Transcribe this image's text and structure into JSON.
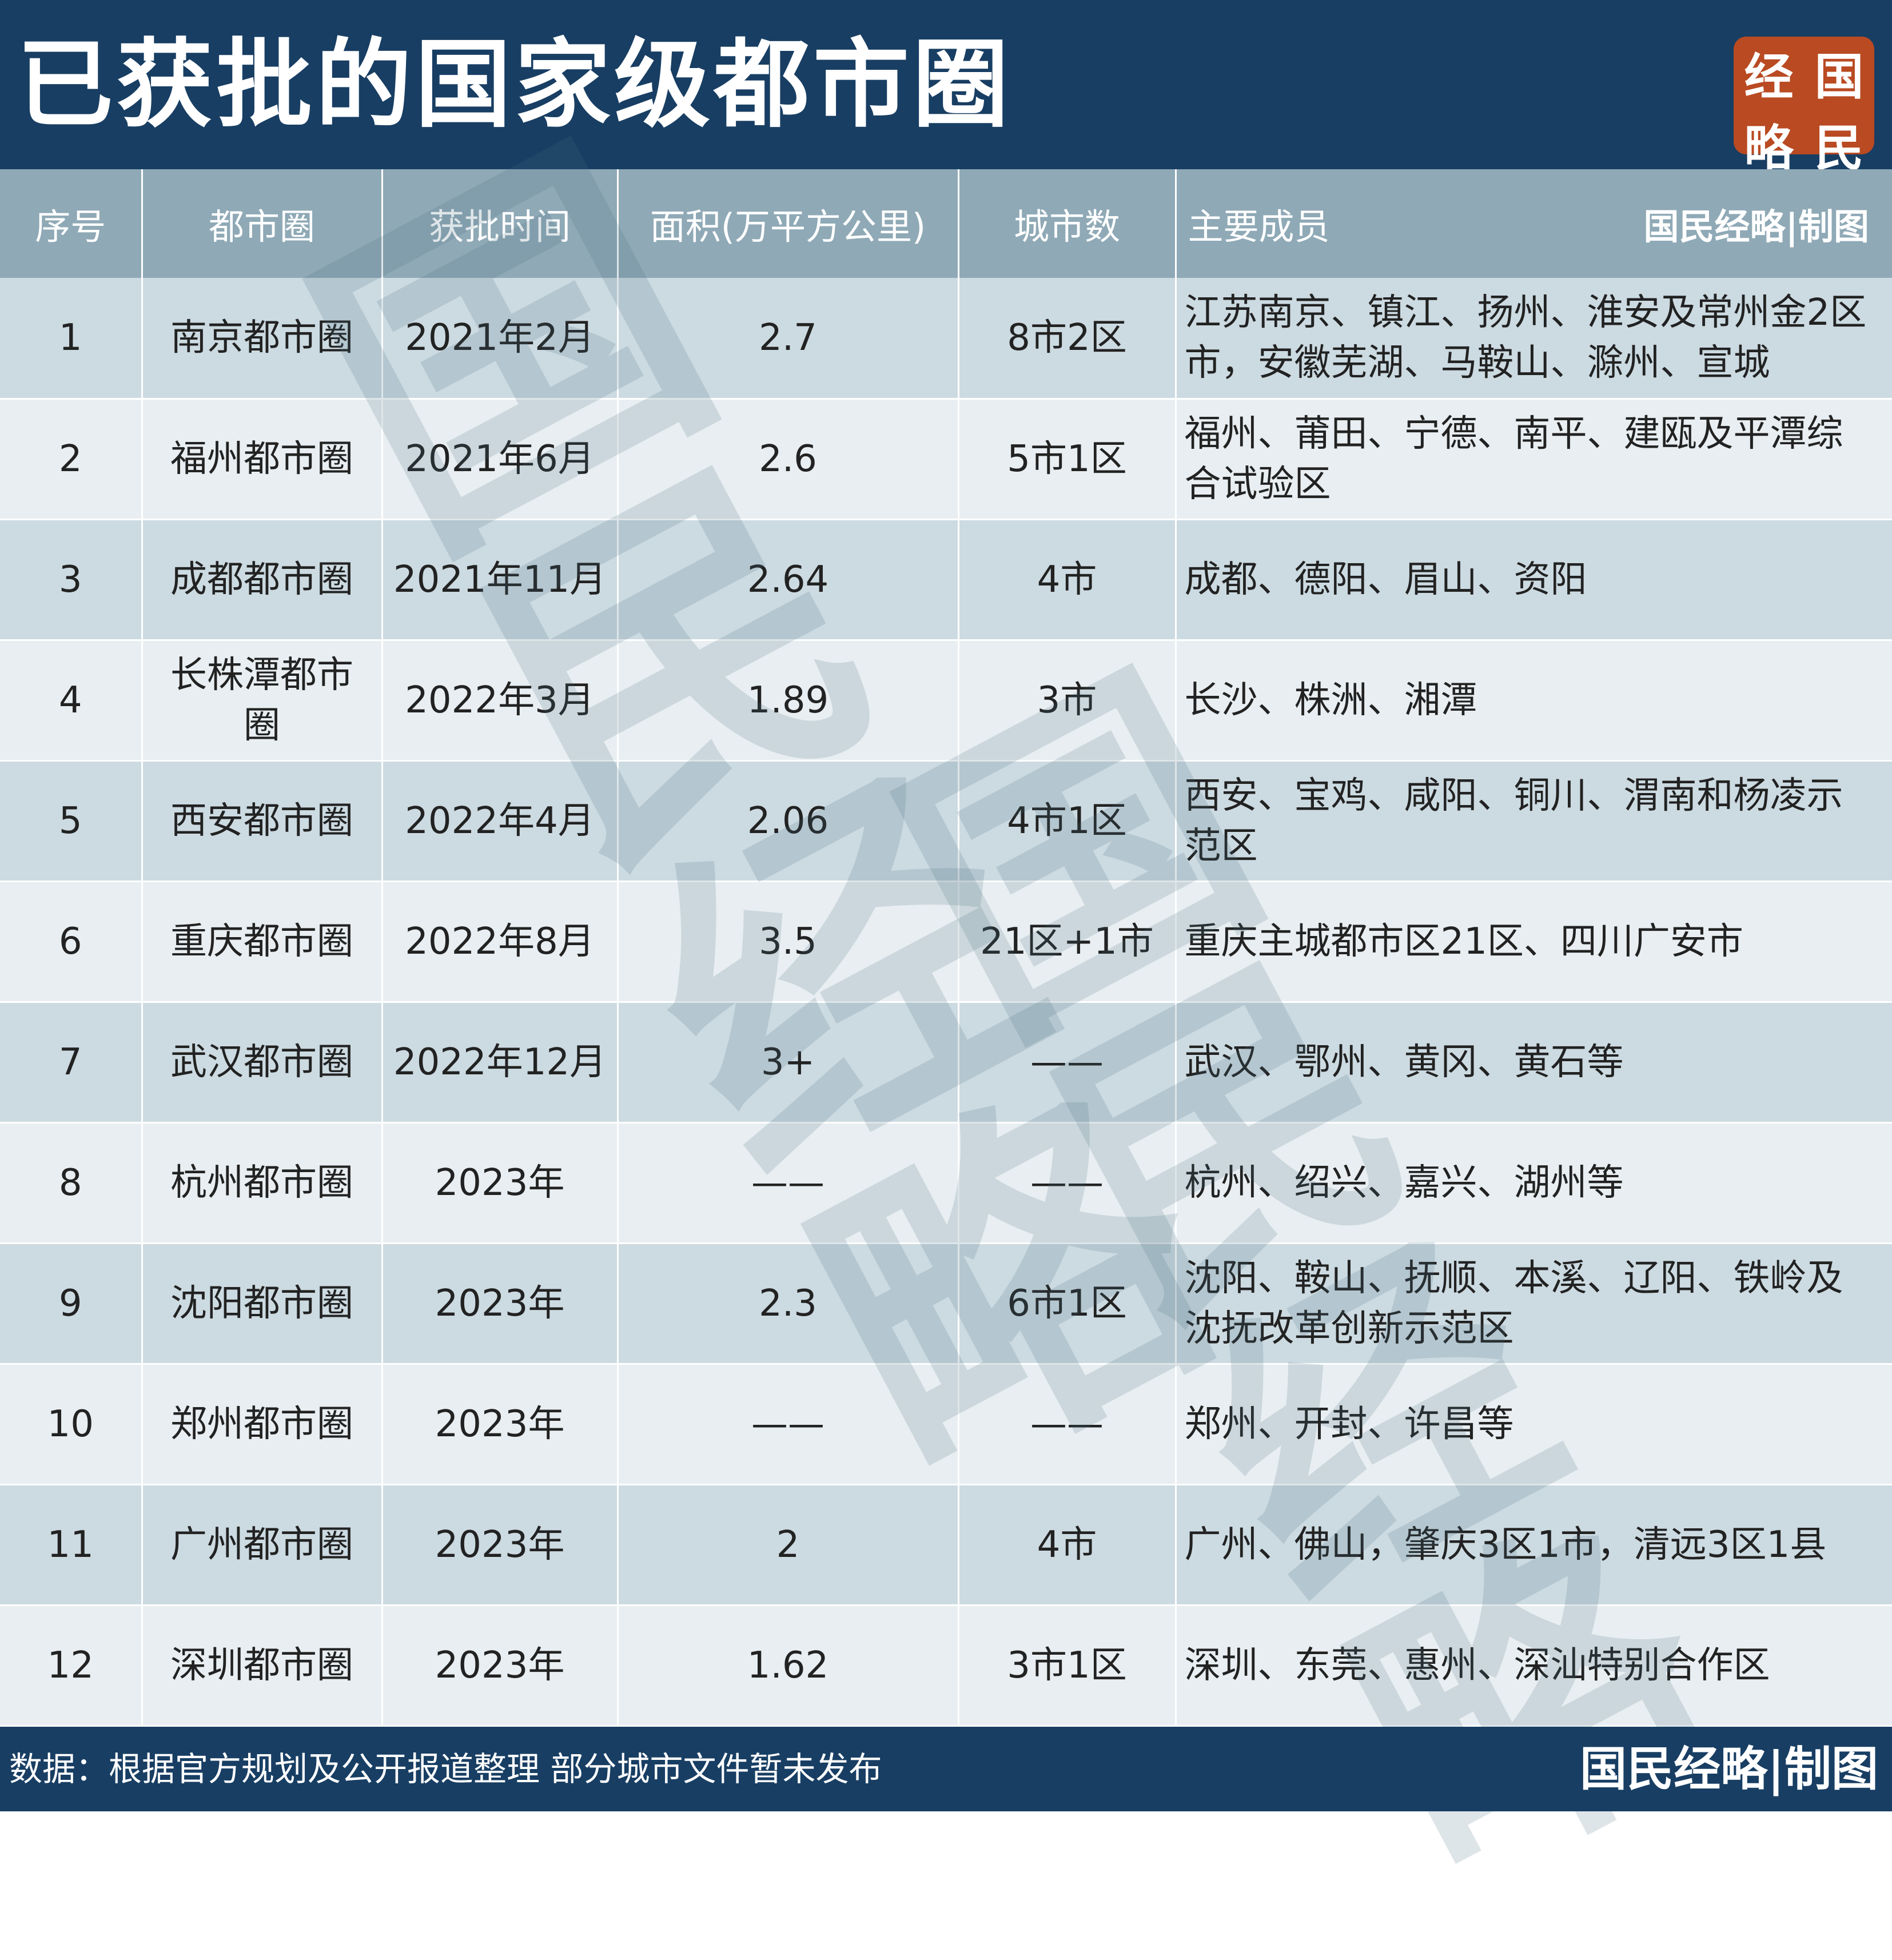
{
  "header": {
    "title": "已获批的国家级都市圈",
    "logo_chars": [
      "国",
      "经",
      "民",
      "略"
    ]
  },
  "watermark_text": "国民经略",
  "table": {
    "columns": [
      "序号",
      "都市圈",
      "获批时间",
      "面积(万平方公里)",
      "城市数",
      "主要成员"
    ],
    "header_credit": "国民经略|制图",
    "rows": [
      {
        "no": "1",
        "name": "南京都市圈",
        "date": "2021年2月",
        "area": "2.7",
        "cities": "8市2区",
        "members": "江苏南京、镇江、扬州、淮安及常州金2区市，安徽芜湖、马鞍山、滁州、宣城"
      },
      {
        "no": "2",
        "name": "福州都市圈",
        "date": "2021年6月",
        "area": "2.6",
        "cities": "5市1区",
        "members": "福州、莆田、宁德、南平、建瓯及平潭综合试验区"
      },
      {
        "no": "3",
        "name": "成都都市圈",
        "date": "2021年11月",
        "area": "2.64",
        "cities": "4市",
        "members": "成都、德阳、眉山、资阳"
      },
      {
        "no": "4",
        "name": "长株潭都市圈",
        "date": "2022年3月",
        "area": "1.89",
        "cities": "3市",
        "members": "长沙、株洲、湘潭"
      },
      {
        "no": "5",
        "name": "西安都市圈",
        "date": "2022年4月",
        "area": "2.06",
        "cities": "4市1区",
        "members": "西安、宝鸡、咸阳、铜川、渭南和杨凌示范区"
      },
      {
        "no": "6",
        "name": "重庆都市圈",
        "date": "2022年8月",
        "area": "3.5",
        "cities": "21区+1市",
        "members": "重庆主城都市区21区、四川广安市"
      },
      {
        "no": "7",
        "name": "武汉都市圈",
        "date": "2022年12月",
        "area": "3+",
        "cities": "——",
        "members": "武汉、鄂州、黄冈、黄石等"
      },
      {
        "no": "8",
        "name": "杭州都市圈",
        "date": "2023年",
        "area": "——",
        "cities": "——",
        "members": "杭州、绍兴、嘉兴、湖州等"
      },
      {
        "no": "9",
        "name": "沈阳都市圈",
        "date": "2023年",
        "area": "2.3",
        "cities": "6市1区",
        "members": "沈阳、鞍山、抚顺、本溪、辽阳、铁岭及沈抚改革创新示范区"
      },
      {
        "no": "10",
        "name": "郑州都市圈",
        "date": "2023年",
        "area": "——",
        "cities": "——",
        "members": "郑州、开封、许昌等"
      },
      {
        "no": "11",
        "name": "广州都市圈",
        "date": "2023年",
        "area": "2",
        "cities": "4市",
        "members": "广州、佛山，肇庆3区1市，清远3区1县"
      },
      {
        "no": "12",
        "name": "深圳都市圈",
        "date": "2023年",
        "area": "1.62",
        "cities": "3市1区",
        "members": "深圳、东莞、惠州、深汕特别合作区"
      }
    ]
  },
  "footer": {
    "source": "数据：根据官方规划及公开报道整理  部分城市文件暂未发布",
    "credit": "国民经略|制图"
  }
}
